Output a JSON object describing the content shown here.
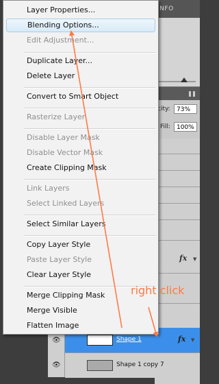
{
  "panel": {
    "tab_label": "INFO",
    "opacity_label": "city:",
    "opacity_value": "73%",
    "fill_label": "Fill:",
    "fill_value": "100%"
  },
  "context_menu": {
    "items": [
      {
        "label": "Layer Properties...",
        "enabled": true
      },
      {
        "label": "Blending Options...",
        "enabled": true,
        "highlighted": true
      },
      {
        "label": "Edit Adjustment...",
        "enabled": false
      },
      {
        "label": "Duplicate Layer...",
        "enabled": true
      },
      {
        "label": "Delete Layer",
        "enabled": true
      },
      {
        "label": "Convert to Smart Object",
        "enabled": true
      },
      {
        "label": "Rasterize Layer",
        "enabled": false
      },
      {
        "label": "Disable Layer Mask",
        "enabled": false
      },
      {
        "label": "Disable Vector Mask",
        "enabled": false
      },
      {
        "label": "Create Clipping Mask",
        "enabled": true
      },
      {
        "label": "Link Layers",
        "enabled": false
      },
      {
        "label": "Select Linked Layers",
        "enabled": false
      },
      {
        "label": "Select Similar Layers",
        "enabled": true
      },
      {
        "label": "Copy Layer Style",
        "enabled": true
      },
      {
        "label": "Paste Layer Style",
        "enabled": false
      },
      {
        "label": "Clear Layer Style",
        "enabled": true
      },
      {
        "label": "Merge Clipping Mask",
        "enabled": true
      },
      {
        "label": "Merge Visible",
        "enabled": true
      },
      {
        "label": "Flatten Image",
        "enabled": true
      }
    ]
  },
  "layers": [
    {
      "name": "Shape 1",
      "selected": true,
      "has_fx": true
    },
    {
      "name": "Shape 1 copy 7",
      "selected": false,
      "has_fx": false
    }
  ],
  "fx_symbol": "fx",
  "annotation": {
    "text": "right click",
    "color": "#ff7a45"
  },
  "colors": {
    "selection_blue": "#3b8fea",
    "menu_highlight_border": "#a8cde9",
    "disabled_text": "#8f8f8f"
  }
}
